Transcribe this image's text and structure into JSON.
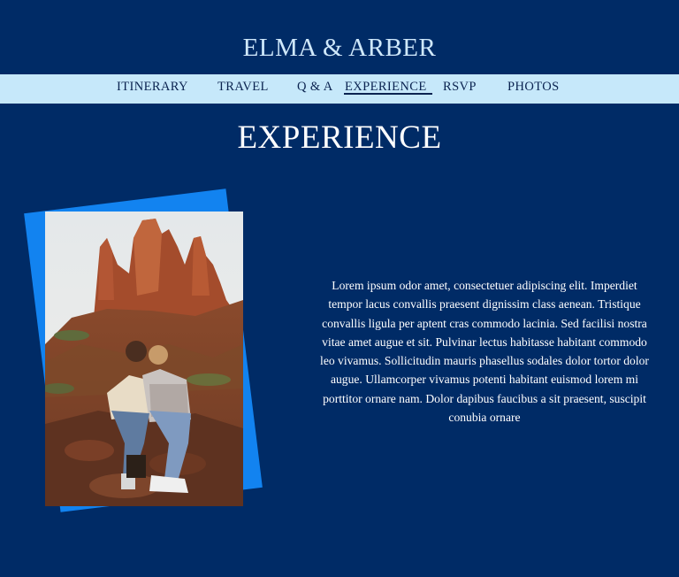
{
  "site": {
    "title": "ELMA & ARBER"
  },
  "nav": {
    "items": [
      {
        "label": "ITINERARY"
      },
      {
        "label": "TRAVEL"
      },
      {
        "label": "Q & A"
      },
      {
        "label": "EXPERIENCE",
        "active": true
      },
      {
        "label": "RSVP"
      },
      {
        "label": "PHOTOS"
      }
    ]
  },
  "page": {
    "title": "EXPERIENCE",
    "body": "Lorem ipsum odor amet, consectetuer adipiscing elit. Imperdiet tempor lacus convallis praesent dignissim class aenean. Tristique convallis ligula per aptent cras commodo lacinia. Sed facilisi nostra vitae amet augue et sit. Pulvinar lectus habitasse habitant commodo leo vivamus. Sollicitudin mauris phasellus sodales dolor tortor dolor augue. Ullamcorper vivamus potenti habitant euismod lorem mi porttitor ornare nam. Dolor dapibus faucibus a sit praesent, suscipit conubia ornare"
  },
  "colors": {
    "background": "#002b66",
    "nav_background": "#c6e8fa",
    "nav_text": "#0b2350",
    "title_text": "#cfe8fb",
    "photo_accent": "#1283f0"
  }
}
